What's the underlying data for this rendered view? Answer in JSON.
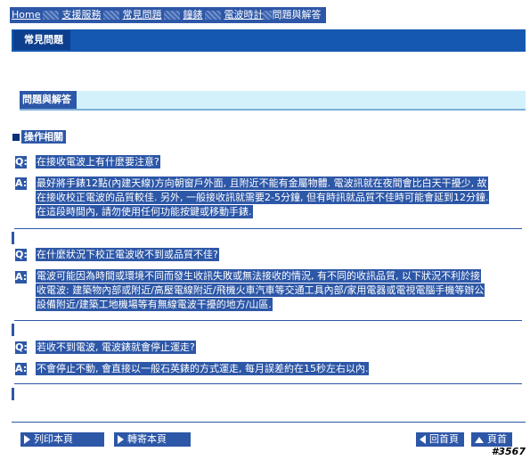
{
  "breadcrumb": {
    "home": "Home",
    "support": "支援服務",
    "faq": "常見問題",
    "watch": "鐘錶",
    "radio": "電波時計",
    "qa": "問題與解答"
  },
  "page_title": "常見問題",
  "section_title": "問題與解答",
  "category": "操作相關",
  "faq": [
    {
      "q_mark": "Q:",
      "question": "在接收電波上有什麼要注意?",
      "a_mark": "A:",
      "answer_lines": [
        "最好將手錶12點(內建天線)方向朝窗戶外面, 且附近不能有金屬物體. 電波訊就在夜間會比白天干擾少, 故",
        "在接收校正電波的品質較佳. 另外, 一般接收訊就需要2-5分鐘, 但有時訊就品質不佳時可能會延到12分鐘.",
        "在這段時間內, 請勿使用任何功能按鍵或移動手錶."
      ]
    },
    {
      "q_mark": "Q:",
      "question": "在什麼狀況下校正電波收不到或品質不佳?",
      "a_mark": "A:",
      "answer_lines": [
        "電波可能因為時間或環境不同而發生收訊失敗或無法接收的情況, 有不同的收訊品質, 以下狀況不利於接",
        "收電波: 建築物內部或附近/高壓電線附近/飛機火車汽車等交通工具內部/家用電器或電視電腦手機等辦公",
        "設備附近/建築工地機場等有無線電波干擾的地方/山區."
      ]
    },
    {
      "q_mark": "Q:",
      "question": "若收不到電波, 電波錶就會停止運走?",
      "a_mark": "A:",
      "answer_lines": [
        "不會停止不動, 會直接以一般石英錶的方式運走, 每月誤差約在15秒左右以內."
      ]
    }
  ],
  "footer": {
    "print": "列印本頁",
    "send": "轉寄本頁",
    "back": "回首頁",
    "top": "頁首"
  },
  "watermark": "#3567",
  "colors": {
    "selection": "#2d57a7",
    "title_bar": "#1458b1",
    "section_bg": "#d3f1fb"
  }
}
